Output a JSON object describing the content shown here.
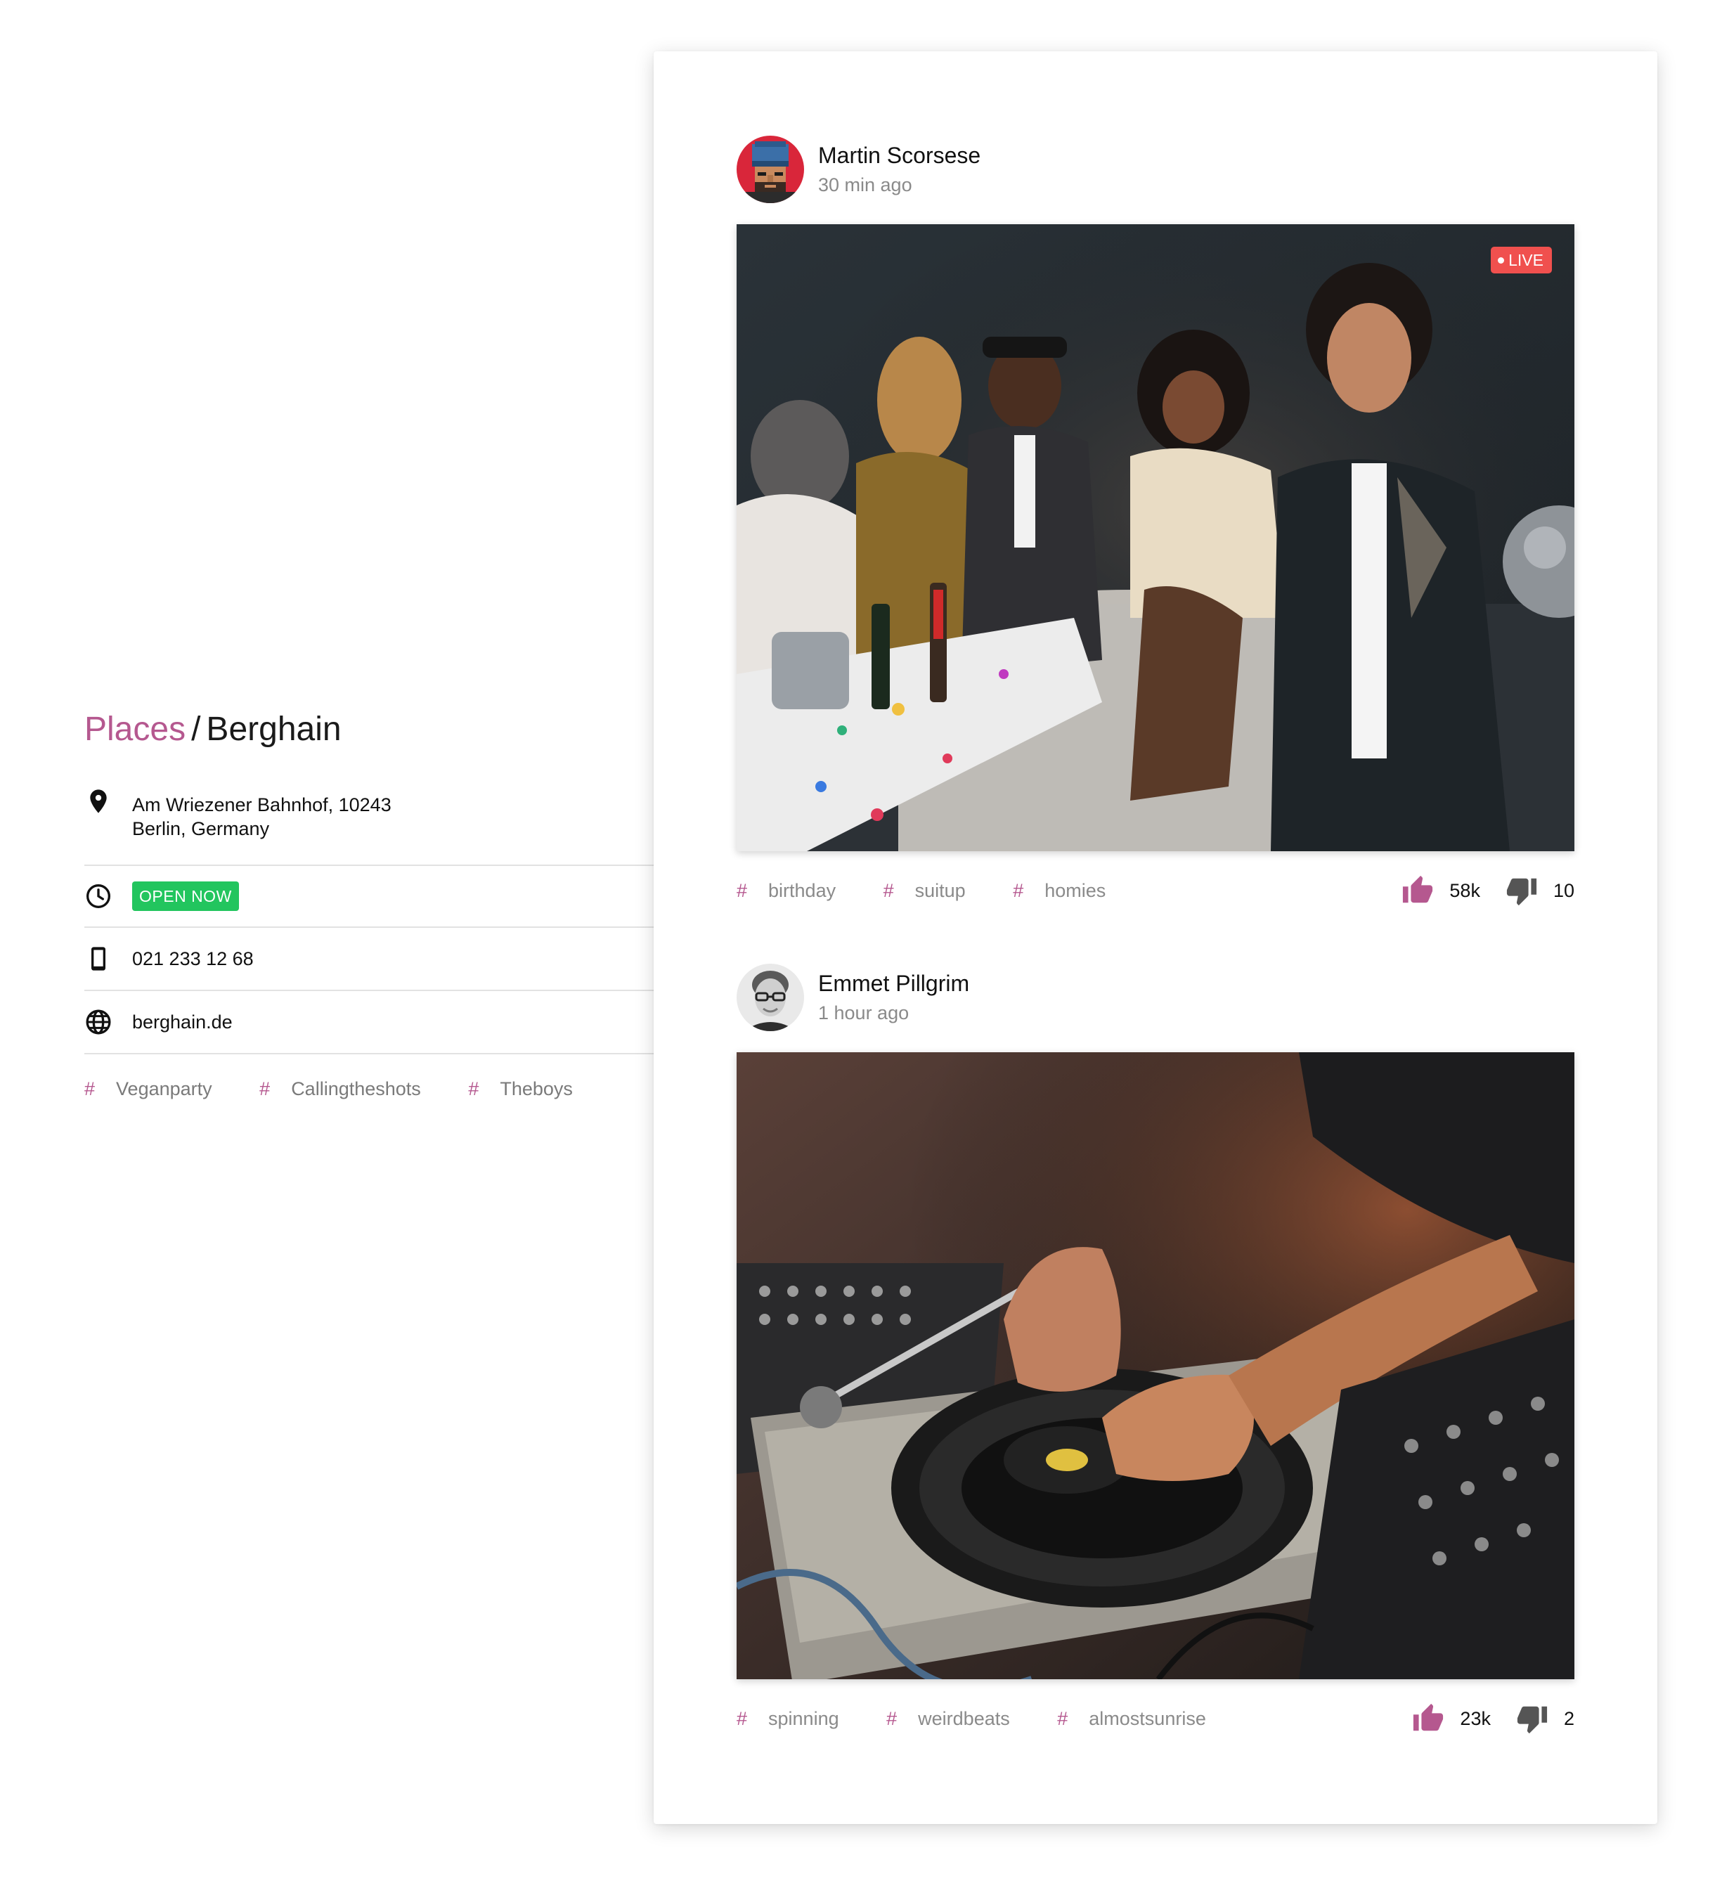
{
  "place": {
    "breadcrumb": {
      "parent": "Places",
      "separator": "/",
      "current": "Berghain"
    },
    "address_line1": "Am Wriezener Bahnhof, 10243",
    "address_line2": "Berlin, Germany",
    "status_badge": "OPEN NOW",
    "phone": "021 233 12 68",
    "website": "berghain.de",
    "tags": [
      "Veganparty",
      "Callingtheshots",
      "Theboys"
    ],
    "icons": [
      "location-pin-icon",
      "clock-icon",
      "phone-icon",
      "globe-icon"
    ],
    "colors": {
      "accent": "#b5588f",
      "open": "#22c55e"
    }
  },
  "feed": {
    "posts": [
      {
        "author": "Martin Scorsese",
        "time": "30 min ago",
        "live_label": "LIVE",
        "tags": [
          "birthday",
          "suitup",
          "homies"
        ],
        "likes": "58k",
        "dislikes": "10"
      },
      {
        "author": "Emmet Pillgrim",
        "time": "1 hour ago",
        "tags": [
          "spinning",
          "weirdbeats",
          "almostsunrise"
        ],
        "likes": "23k",
        "dislikes": "2"
      }
    ],
    "colors": {
      "like": "#b5588f",
      "dislike": "#555555",
      "live": "#f0504e"
    }
  }
}
